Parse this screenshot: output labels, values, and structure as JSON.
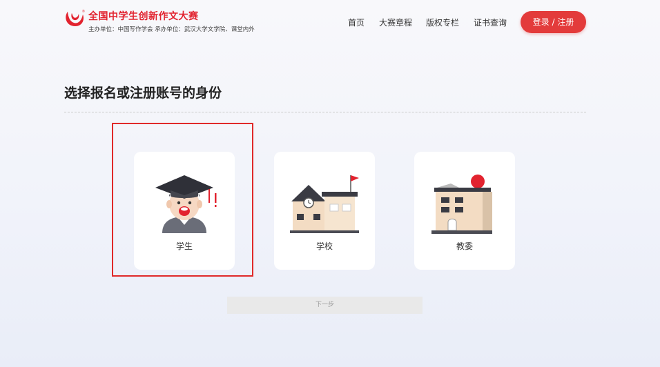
{
  "header": {
    "title": "全国中学生创新作文大赛",
    "subtitle": "主办单位：中国写作学会 承办单位：武汉大学文学院、课堂内外",
    "nav": [
      "首页",
      "大赛章程",
      "版权专栏",
      "证书查询"
    ],
    "login_label": "登录 / 注册",
    "logo_icon": "brand-swirl-logo",
    "accent_color": "#e33b3b"
  },
  "main": {
    "title": "选择报名或注册账号的身份",
    "roles": [
      {
        "label": "学生",
        "icon": "student-icon",
        "selected": true
      },
      {
        "label": "学校",
        "icon": "school-icon",
        "selected": false
      },
      {
        "label": "教委",
        "icon": "education-bureau-icon",
        "selected": false
      }
    ],
    "next_label": "下一步"
  }
}
